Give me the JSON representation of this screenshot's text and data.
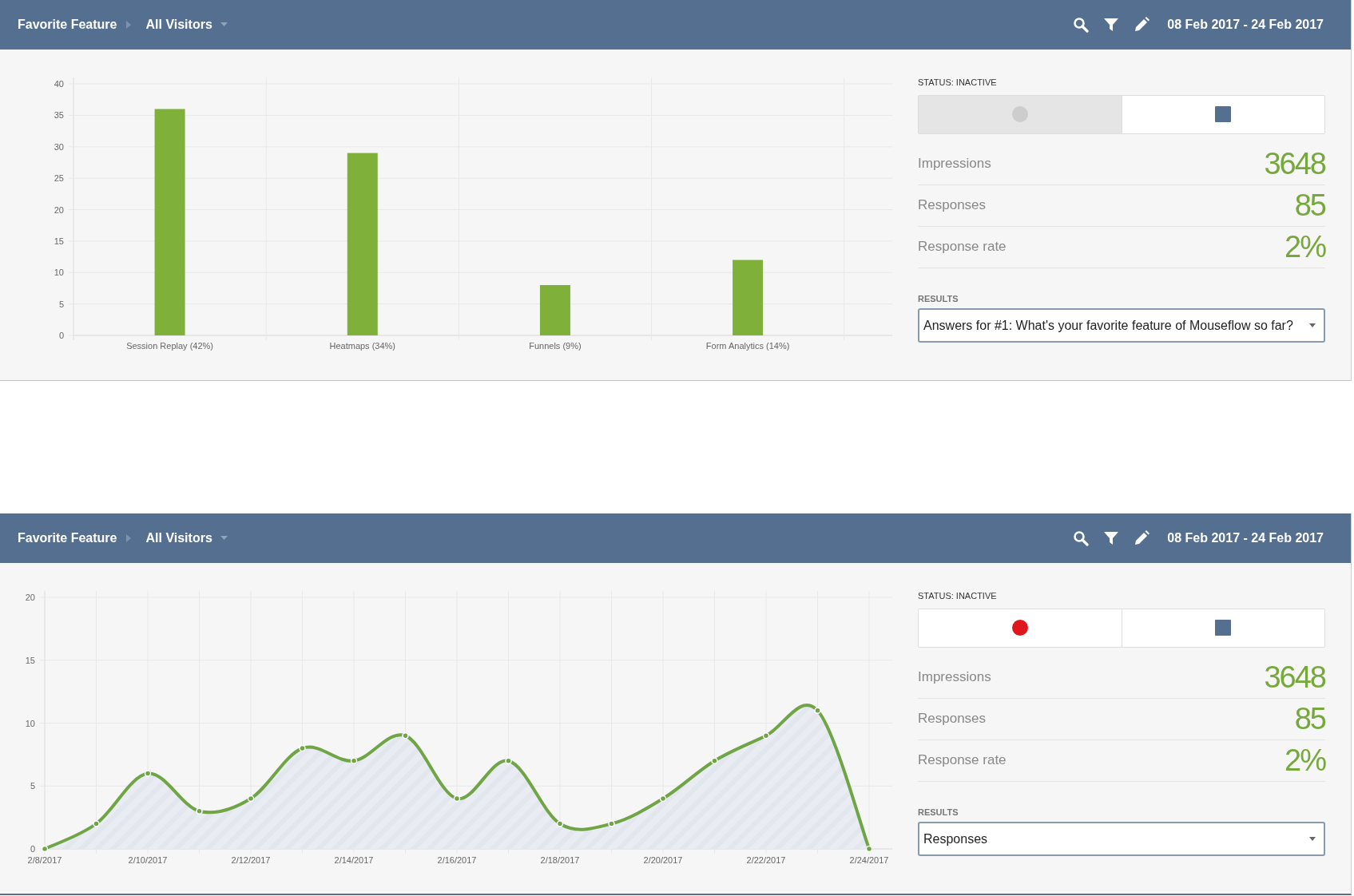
{
  "panels": [
    {
      "header": {
        "title": "Favorite Feature",
        "segment": "All Visitors",
        "date_range": "08 Feb 2017 - 24 Feb 2017"
      },
      "chart_data": {
        "type": "bar",
        "categories": [
          "Session Replay (42%)",
          "Heatmaps (34%)",
          "Funnels (9%)",
          "Form Analytics (14%)"
        ],
        "series": [
          {
            "color": "#7fb03a",
            "values": [
              36,
              29,
              8,
              12
            ]
          }
        ],
        "grid": true,
        "ylim": [
          0,
          40
        ],
        "yticks": [
          0,
          5,
          10,
          15,
          20,
          25,
          30,
          35,
          40
        ]
      },
      "status": {
        "label": "STATUS: INACTIVE",
        "record_button": {
          "disabled": true
        }
      },
      "stats": [
        {
          "label": "Impressions",
          "value": "3648"
        },
        {
          "label": "Responses",
          "value": "85"
        },
        {
          "label": "Response rate",
          "value": "2%"
        }
      ],
      "results": {
        "label": "RESULTS",
        "value": "Answers for #1: What's your favorite feature of Mouseflow so far?"
      }
    },
    {
      "header": {
        "title": "Favorite Feature",
        "segment": "All Visitors",
        "date_range": "08 Feb 2017 - 24 Feb 2017"
      },
      "chart_data": {
        "type": "area",
        "categories": [
          "2/8/2017",
          null,
          "2/10/2017",
          null,
          "2/12/2017",
          null,
          "2/14/2017",
          null,
          "2/16/2017",
          null,
          "2/18/2017",
          null,
          "2/20/2017",
          null,
          "2/22/2017",
          null,
          "2/24/2017"
        ],
        "series": [
          {
            "color": "#6fa544",
            "values": [
              0,
              2,
              6,
              3,
              4,
              8,
              7,
              9,
              4,
              7,
              2,
              2,
              4,
              7,
              9,
              11,
              0
            ]
          }
        ],
        "grid": true,
        "ylim": [
          0,
          20
        ],
        "yticks": [
          0,
          5,
          10,
          15,
          20
        ]
      },
      "status": {
        "label": "STATUS: INACTIVE",
        "record_button": {
          "disabled": false
        }
      },
      "stats": [
        {
          "label": "Impressions",
          "value": "3648"
        },
        {
          "label": "Responses",
          "value": "85"
        },
        {
          "label": "Response rate",
          "value": "2%"
        }
      ],
      "results": {
        "label": "RESULTS",
        "value": "Responses"
      }
    }
  ]
}
